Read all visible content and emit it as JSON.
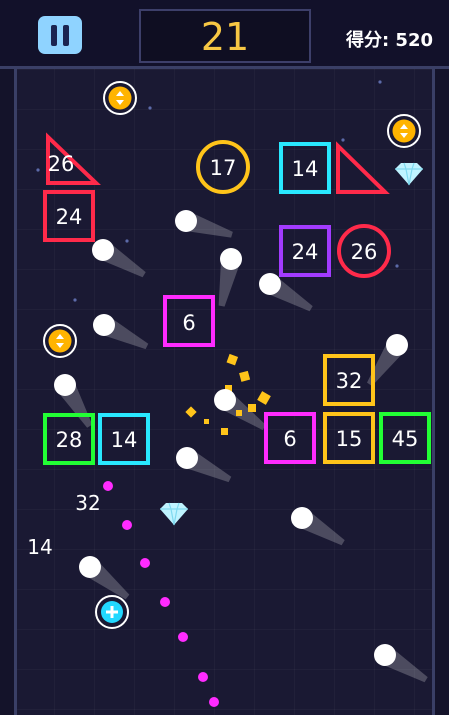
{
  "hud": {
    "level": "21",
    "score_text": "得分: 520"
  },
  "colors": {
    "red": "#ff2a4a",
    "yellow": "#ffc41a",
    "cyan": "#29e8ff",
    "purple": "#a23bff",
    "magenta": "#ff2bff",
    "green": "#22ff34",
    "ball": "#ffffff",
    "aim": "#ff2bff",
    "coin": "#ffb400",
    "plus": "#22d8ff",
    "diamond": "#bff3ff",
    "pause": "#8fd3ff"
  },
  "blocks": [
    {
      "shape": "triangle",
      "value": "26",
      "color": "red"
    },
    {
      "shape": "square",
      "value": "24",
      "color": "red"
    },
    {
      "shape": "circle",
      "value": "17",
      "color": "yellow"
    },
    {
      "shape": "square",
      "value": "14",
      "color": "cyan"
    },
    {
      "shape": "triangle",
      "value": "",
      "color": "red"
    },
    {
      "shape": "square",
      "value": "24",
      "color": "purple"
    },
    {
      "shape": "circle",
      "value": "26",
      "color": "red"
    },
    {
      "shape": "square",
      "value": "6",
      "color": "magenta"
    },
    {
      "shape": "square",
      "value": "32",
      "color": "yellow"
    },
    {
      "shape": "square",
      "value": "28",
      "color": "green"
    },
    {
      "shape": "square",
      "value": "14",
      "color": "cyan"
    },
    {
      "shape": "square",
      "value": "6",
      "color": "magenta"
    },
    {
      "shape": "square",
      "value": "15",
      "color": "yellow"
    },
    {
      "shape": "square",
      "value": "45",
      "color": "green"
    }
  ],
  "floating_numbers": [
    "32",
    "14"
  ],
  "icons": {
    "coin": "coin-arrows-icon",
    "diamond": "diamond-icon",
    "plus": "plus-ball-icon",
    "pause": "pause-icon"
  }
}
